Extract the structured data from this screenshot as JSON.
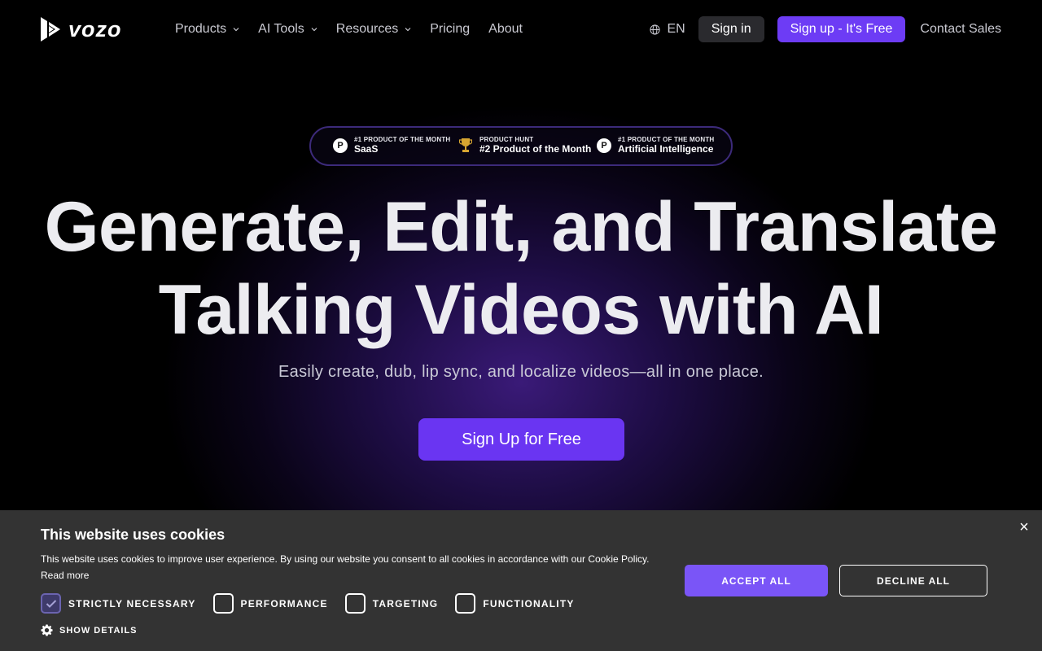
{
  "brand": {
    "name": "vozo"
  },
  "nav": {
    "items": [
      {
        "label": "Products",
        "dropdown": true
      },
      {
        "label": "AI Tools",
        "dropdown": true
      },
      {
        "label": "Resources",
        "dropdown": true
      },
      {
        "label": "Pricing",
        "dropdown": false
      },
      {
        "label": "About",
        "dropdown": false
      }
    ],
    "language": "EN",
    "signin_label": "Sign in",
    "signup_label": "Sign up - It's Free",
    "contact_label": "Contact Sales"
  },
  "awards": [
    {
      "small": "#1 PRODUCT OF THE MONTH",
      "big": "SaaS",
      "icon": "product-hunt-icon"
    },
    {
      "small": "PRODUCT HUNT",
      "big": "#2 Product of the Month",
      "icon": "trophy-icon"
    },
    {
      "small": "#1 PRODUCT OF THE MONTH",
      "big": "Artificial Intelligence",
      "icon": "product-hunt-icon"
    }
  ],
  "hero": {
    "headline_line1": "Generate, Edit, and Translate",
    "headline_line2": "Talking Videos with AI",
    "subheadline": "Easily create, dub, lip sync, and localize videos—all in one place.",
    "cta_label": "Sign Up for Free"
  },
  "cookie": {
    "title": "This website uses cookies",
    "text": "This website uses cookies to improve user experience. By using our website you consent to all cookies in accordance with our Cookie Policy.",
    "read_more": "Read more",
    "checkboxes": [
      {
        "label": "STRICTLY NECESSARY",
        "checked": true
      },
      {
        "label": "PERFORMANCE",
        "checked": false
      },
      {
        "label": "TARGETING",
        "checked": false
      },
      {
        "label": "FUNCTIONALITY",
        "checked": false
      }
    ],
    "show_details": "SHOW DETAILS",
    "accept_label": "ACCEPT ALL",
    "decline_label": "DECLINE ALL",
    "close_symbol": "×"
  },
  "colors": {
    "accent": "#6d3cf5",
    "cookie_bg": "#333333",
    "accept_bg": "#7a55f7"
  }
}
